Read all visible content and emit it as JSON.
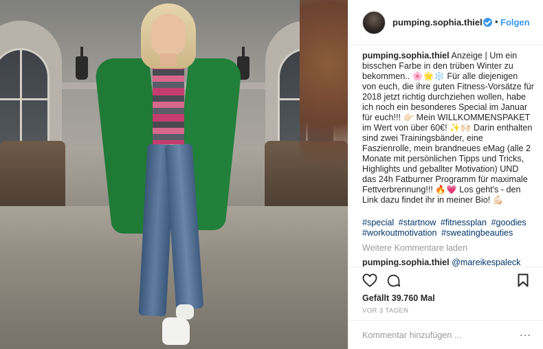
{
  "post": {
    "username": "pumping.sophia.thiel",
    "follow_label": "Folgen",
    "dot": "•"
  },
  "caption": {
    "username": "pumping.sophia.thiel",
    "text": " Anzeige | Um ein bisschen Farbe in den trüben Winter zu bekommen.. 🌸🌟❄️ Für alle diejenigen von euch, die ihre guten Fitness-Vorsätze für 2018 jetzt richtig durchziehen wollen, habe ich noch ein besonderes Special im Januar für euch!!! 👉🏻 Mein WILLKOMMENSPAKET im Wert von über 60€! ✨🙌🏻 Darin enthalten sind zwei Trainingsbänder, eine Faszienrolle, mein brandneues eMag (alle 2 Monate mit persönlichen Tipps und Tricks, Highlights und geballter Motivation) UND das 24h Fatburner Programm für maximale Fettverbrennung!!! 🔥💗 Los geht's - den Link dazu findet ihr in meiner Bio! 💪🏻",
    "hashtags": [
      "#special",
      "#startnow",
      "#fitnessplan",
      "#goodies",
      "#workoutmotivation",
      "#sweatingbeauties"
    ]
  },
  "load_more": "Weitere Kommentare laden",
  "comment": {
    "username": "pumping.sophia.thiel",
    "mention": "@mareikespaleck"
  },
  "likes": "Gefällt 39.760 Mal",
  "time_ago": "VOR 3 TAGEN",
  "add_comment": {
    "placeholder": "Kommentar hinzufügen ...",
    "options": "···"
  },
  "icons": {
    "like": "heart-icon",
    "comment": "comment-icon",
    "save": "bookmark-icon",
    "verified": "verified-badge-icon",
    "options": "more-options-icon"
  },
  "colors": {
    "link_blue": "#3897f0",
    "hashtag": "#003569",
    "muted": "#999999",
    "text": "#262626"
  }
}
